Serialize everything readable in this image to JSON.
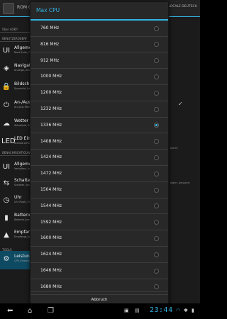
{
  "background": {
    "app_title": "ROM C",
    "locale_label": "LOCALE DEUTSCH",
    "sections": [
      "Über AOKP",
      "BENUTZEROBERF",
      "BENACHRICHTIGUNG",
      "TOOLS"
    ],
    "items": [
      {
        "title": "Allgeme",
        "subtitle": "Boot Anim, Farbeinste",
        "icon": "ui-icon",
        "glyph": "UI"
      },
      {
        "title": "Navigat",
        "subtitle": "Anzeige, Aktion",
        "icon": "navigation-icon",
        "glyph": "◈"
      },
      {
        "title": "Bildschi",
        "subtitle": "Sperrbild, Layout",
        "icon": "lockscreen-icon",
        "glyph": "🔒"
      },
      {
        "title": "An-/Aus",
        "subtitle": "An-/Aus Menü, Einstellungen",
        "icon": "power-icon",
        "glyph": "⏻"
      },
      {
        "title": "Wetter",
        "subtitle": "Aktualisie, Eigene Stadt",
        "icon": "weather-icon",
        "glyph": "☁"
      },
      {
        "title": "LED Ein",
        "subtitle": "Standard-Farbe, Android",
        "icon": "led-icon",
        "glyph": "LED"
      },
      {
        "title": "Allgeme",
        "subtitle": "Verhalten, Ändern",
        "icon": "notification-ui-icon",
        "glyph": "UI"
      },
      {
        "title": "Schalte",
        "subtitle": "Schalter, Anordnung",
        "icon": "toggle-icon",
        "glyph": "⇆"
      },
      {
        "title": "Uhr",
        "subtitle": "Uhr Positi, Format",
        "icon": "clock-icon",
        "glyph": "◷"
      },
      {
        "title": "Batterie",
        "subtitle": "Batterie-Anzeige, Modus",
        "icon": "battery-icon",
        "glyph": "▮"
      },
      {
        "title": "Empfan",
        "subtitle": "Empfangs-Anzeige",
        "icon": "signal-icon",
        "glyph": "▲"
      },
      {
        "title": "Leistung",
        "subtitle": "CPU-Einstellungen, Takt",
        "icon": "performance-icon",
        "glyph": "⚙"
      }
    ],
    "fragments": [
      "bsicht",
      "eigen, beispiele"
    ]
  },
  "dialog": {
    "title": "Max CPU",
    "selected": "1336 MHz",
    "options": [
      "760 MHz",
      "816 MHz",
      "912 MHz",
      "1000 MHz",
      "1200 MHz",
      "1232 MHz",
      "1336 MHz",
      "1408 MHz",
      "1424 MHz",
      "1472 MHz",
      "1504 MHz",
      "1544 MHz",
      "1592 MHz",
      "1600 MHz",
      "1624 MHz",
      "1646 MHz",
      "1680 MHz"
    ],
    "cancel_label": "Abbruch"
  },
  "navbar": {
    "clock": "23:44",
    "icons": [
      "back-icon",
      "home-icon",
      "recent-apps-icon",
      "notification-icon",
      "wifi-icon",
      "bluetooth-icon",
      "battery-status-icon"
    ]
  }
}
